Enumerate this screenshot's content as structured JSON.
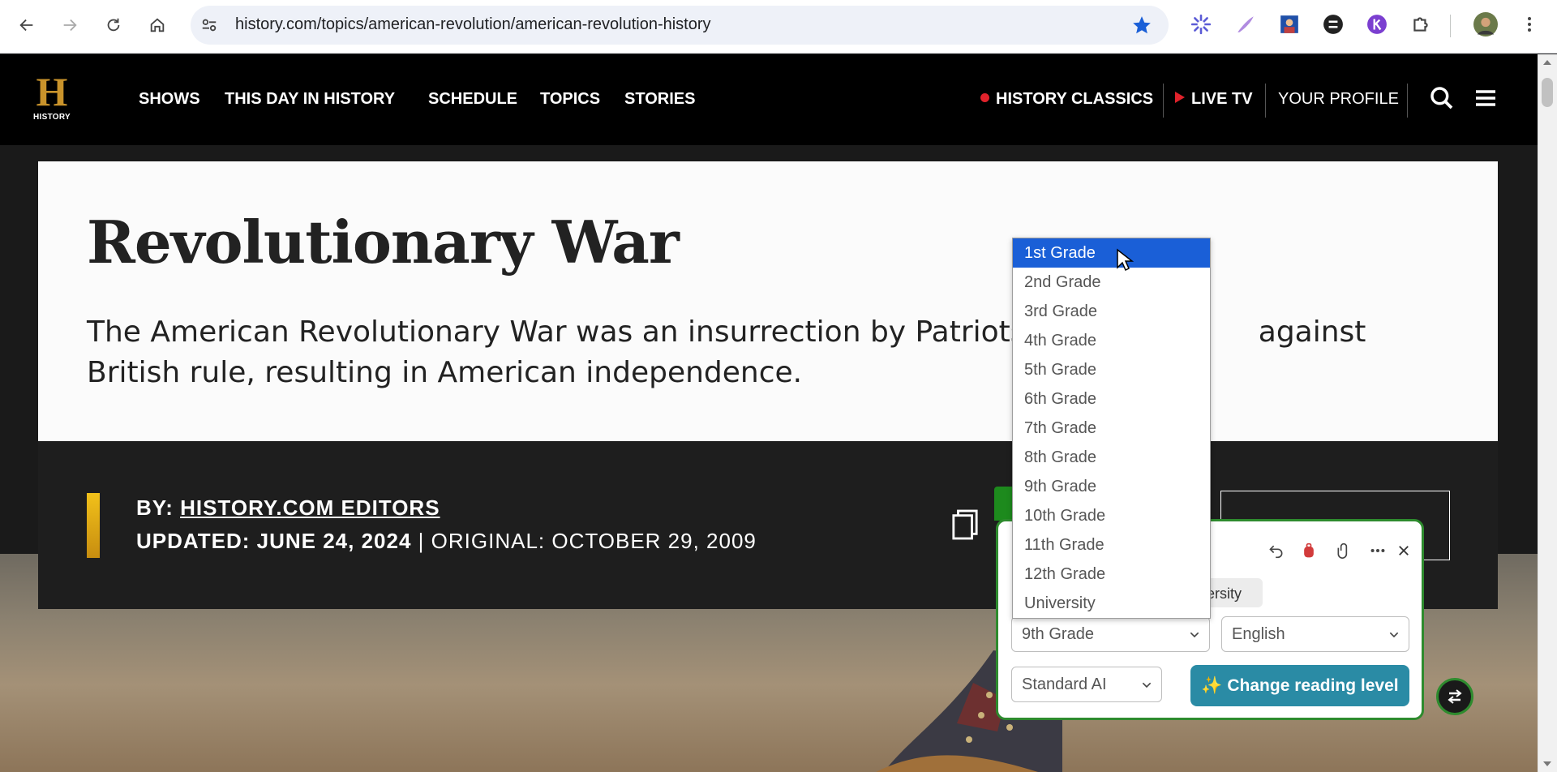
{
  "browser": {
    "url": "history.com/topics/american-revolution/american-revolution-history"
  },
  "site": {
    "logo_word": "HISTORY",
    "logo_letter": "H",
    "nav": [
      "SHOWS",
      "THIS DAY IN HISTORY",
      "SCHEDULE",
      "TOPICS",
      "STORIES"
    ],
    "classics": "HISTORY CLASSICS",
    "live_tv": "LIVE TV",
    "profile": "YOUR PROFILE"
  },
  "article": {
    "title": "Revolutionary War",
    "summary": "The American Revolutionary War was an insurrection by Patriots in t                   against British rule, resulting in American independence.",
    "by_label": "BY:",
    "author": "HISTORY.COM EDITORS",
    "updated_label": "UPDATED: JUNE 24, 2024",
    "separator": "|",
    "original_label": "ORIGINAL: OCTOBER 29, 2009"
  },
  "extension": {
    "chip_text": "iversity",
    "grade_value": "9th Grade",
    "language_value": "English",
    "model_value": "Standard AI",
    "change_button": "✨ Change reading level",
    "grade_options": [
      "1st Grade",
      "2nd Grade",
      "3rd Grade",
      "4th Grade",
      "5th Grade",
      "6th Grade",
      "7th Grade",
      "8th Grade",
      "9th Grade",
      "10th Grade",
      "11th Grade",
      "12th Grade",
      "University"
    ],
    "highlighted_option": "1st Grade"
  },
  "colors": {
    "accent_green": "#2e8b2e",
    "button_teal": "#2a8ba5",
    "highlight_blue": "#1a5fd7",
    "history_gold": "#c9932b",
    "live_red": "#e0222b"
  }
}
